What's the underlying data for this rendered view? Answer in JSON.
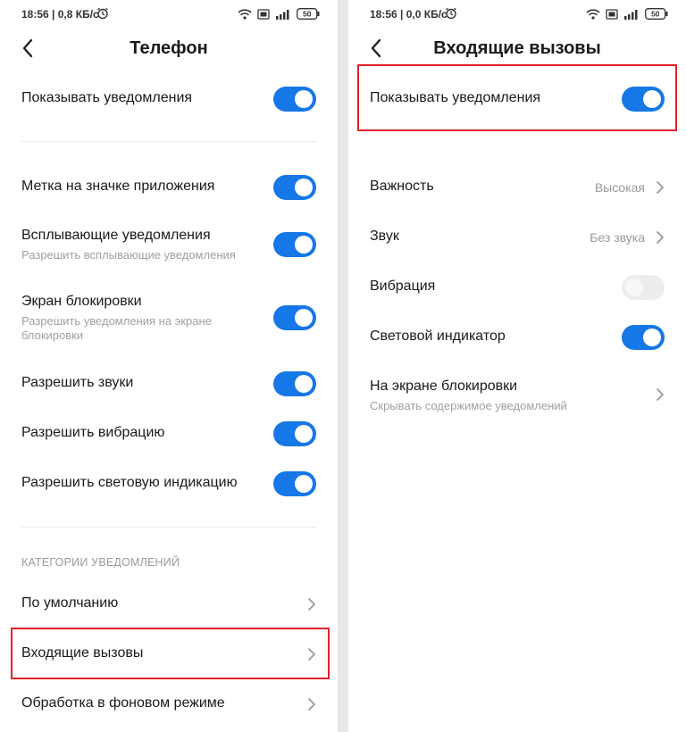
{
  "left": {
    "status": {
      "time": "18:56",
      "speed": "0,8 КБ/с",
      "battery": "50"
    },
    "title": "Телефон",
    "toggles": [
      {
        "label": "Показывать уведомления",
        "on": true
      },
      {
        "label": "Метка на значке приложения",
        "on": true
      },
      {
        "label": "Всплывающие уведомления",
        "sub": "Разрешить всплывающие уведомления",
        "on": true
      },
      {
        "label": "Экран блокировки",
        "sub1": "Разрешить уведомления на экране",
        "sub2": "блокировки",
        "on": true
      },
      {
        "label": "Разрешить звуки",
        "on": true
      },
      {
        "label": "Разрешить вибрацию",
        "on": true
      },
      {
        "label": "Разрешить световую индикацию",
        "on": true
      }
    ],
    "section_header": "КАТЕГОРИИ УВЕДОМЛЕНИЙ",
    "categories": [
      "По умолчанию",
      "Входящие вызовы",
      "Обработка в фоновом режиме"
    ]
  },
  "right": {
    "status": {
      "time": "18:56",
      "speed": "0,0 КБ/с",
      "battery": "50"
    },
    "title": "Входящие вызовы",
    "show_notifications": {
      "label": "Показывать уведомления",
      "on": true
    },
    "importance": {
      "label": "Важность",
      "value": "Высокая"
    },
    "sound": {
      "label": "Звук",
      "value": "Без звука"
    },
    "vibration": {
      "label": "Вибрация",
      "on": false
    },
    "led": {
      "label": "Световой индикатор",
      "on": true
    },
    "lockscreen": {
      "label": "На экране блокировки",
      "sub": "Скрывать содержимое уведомлений"
    }
  },
  "colors": {
    "accent": "#1677e6",
    "highlight": "#e0222a"
  },
  "icons": [
    "alarm-icon",
    "wifi-icon",
    "sim-icon",
    "signal-icon",
    "battery-icon",
    "back-arrow-icon",
    "chevron-right-icon"
  ]
}
